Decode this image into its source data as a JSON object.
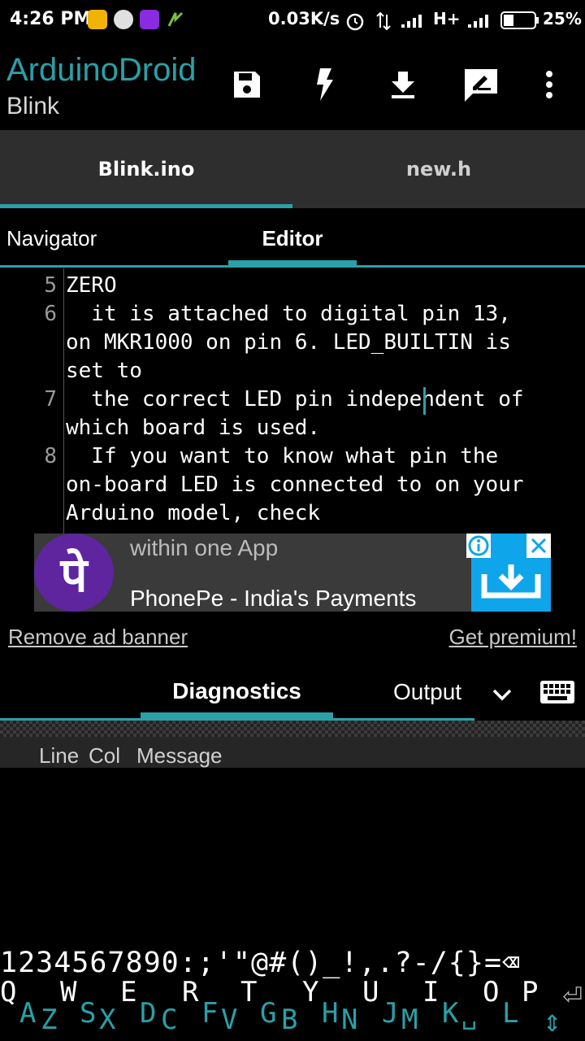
{
  "status_bar": {
    "time": "4:26 PM",
    "net_speed": "0.03K/s",
    "network_type": "H+",
    "battery": "25%"
  },
  "app_bar": {
    "title": "ArduinoDroid",
    "subtitle": "Blink",
    "actions": [
      "save-icon",
      "flash-icon",
      "download-icon",
      "edit-icon",
      "more-vert-icon"
    ]
  },
  "file_tabs": [
    {
      "label": "Blink.ino",
      "active": true
    },
    {
      "label": "new.h",
      "active": false
    }
  ],
  "view_tabs": {
    "navigator": "Navigator",
    "editor": "Editor"
  },
  "editor": {
    "lines": [
      {
        "number": "5",
        "rows": [
          "ZERO"
        ]
      },
      {
        "number": "6",
        "rows": [
          "  it is attached to digital pin 13,",
          "on MKR1000 on pin 6. LED_BUILTIN is",
          "set to"
        ]
      },
      {
        "number": "7",
        "rows": [
          "  the correct LED pin independent of",
          "which board is used."
        ]
      },
      {
        "number": "8",
        "rows": [
          "  If you want to know what pin the",
          "on-board LED is connected to on your",
          "Arduino model, check"
        ]
      }
    ]
  },
  "ad": {
    "logo_text": "पे",
    "line1": "within one App",
    "line2": "PhonePe - India's Payments",
    "info": "ⓘ",
    "close": "✕"
  },
  "links": {
    "remove_ad": "Remove ad banner",
    "get_premium": "Get premium!"
  },
  "bottom_tabs": {
    "diagnostics": "Diagnostics",
    "output": "Output"
  },
  "diagnostics_header": {
    "line": "Line",
    "col": "Col",
    "message": "Message"
  },
  "keyboard": {
    "symbols_row": "1234567890:;'\"@#()_!,.?-/{}=⌫",
    "letter_keys": [
      {
        "up": "Q",
        "down": "A"
      },
      {
        "up": "W",
        "down": "S"
      },
      {
        "up": "E",
        "down": "D"
      },
      {
        "up": "R",
        "down": "F"
      },
      {
        "up": "T",
        "down": "G"
      },
      {
        "up": "Y",
        "down": "H"
      },
      {
        "up": "U",
        "down": "J"
      },
      {
        "up": "I",
        "down": "K"
      },
      {
        "up": "O",
        "down": "L"
      },
      {
        "up": "P",
        "down": ""
      }
    ],
    "bottom_letters": [
      "Z",
      "X",
      "C",
      "V",
      "B",
      "N",
      "M"
    ],
    "enter_icon": "⏎",
    "shift_icon": "⇕",
    "space_icon": "␣"
  },
  "colors": {
    "accent": "#2aa0a8",
    "tab_bg": "#2e2e2e",
    "ad_bg": "#3a3a3a",
    "phonepe_purple": "#5f259f",
    "ad_cta_blue": "#0ea5ea"
  }
}
